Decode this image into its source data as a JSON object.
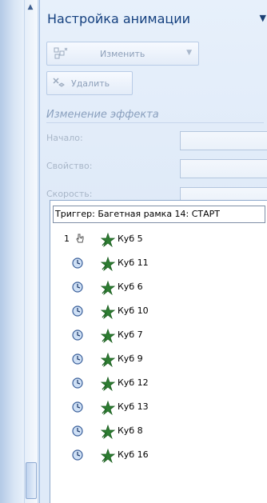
{
  "pane": {
    "title": "Настройка анимации",
    "change_button": "Изменить",
    "delete_button": "Удалить",
    "section_header": "Изменение эффекта",
    "fields": [
      {
        "label": "Начало:"
      },
      {
        "label": "Свойство:"
      },
      {
        "label": "Скорость:"
      }
    ]
  },
  "list": {
    "trigger": "Триггер: Багетная рамка 14: СТАРТ",
    "items": [
      {
        "number": "1",
        "timing": "on-click",
        "name": "Куб 5"
      },
      {
        "number": "",
        "timing": "after-previous",
        "name": "Куб 11"
      },
      {
        "number": "",
        "timing": "after-previous",
        "name": "Куб 6"
      },
      {
        "number": "",
        "timing": "after-previous",
        "name": "Куб 10"
      },
      {
        "number": "",
        "timing": "after-previous",
        "name": "Куб 7"
      },
      {
        "number": "",
        "timing": "after-previous",
        "name": "Куб 9"
      },
      {
        "number": "",
        "timing": "after-previous",
        "name": "Куб 12"
      },
      {
        "number": "",
        "timing": "after-previous",
        "name": "Куб 13"
      },
      {
        "number": "",
        "timing": "after-previous",
        "name": "Куб 8"
      },
      {
        "number": "",
        "timing": "after-previous",
        "name": "Куб 16"
      }
    ]
  },
  "icons": {
    "change": "add-effect-icon",
    "delete": "remove-effect-icon",
    "on_click": "mouse-hand-icon",
    "after_previous": "clock-icon",
    "effect": "green-star-effect-icon"
  },
  "colors": {
    "pane_background": "#dfeaf8",
    "title_text": "#14407f",
    "disabled_text": "#8ea0ba",
    "effect_star": "#2e7d32"
  }
}
